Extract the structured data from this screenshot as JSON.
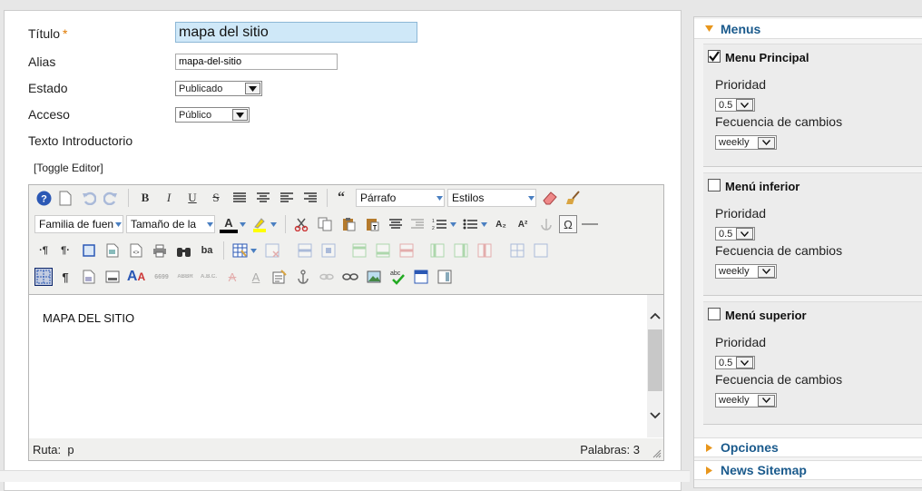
{
  "form": {
    "title_label": "Título",
    "required_mark": "*",
    "title_value": "mapa del sitio",
    "alias_label": "Alias",
    "alias_value": "mapa-del-sitio",
    "state_label": "Estado",
    "state_value": "Publicado",
    "access_label": "Acceso",
    "access_value": "Público",
    "intro_label": "Texto Introductorio",
    "toggle_editor": "[Toggle Editor]"
  },
  "editor": {
    "paragraph_format": "Párrafo",
    "styles": "Estilos",
    "font_family": "Familia de fuen",
    "font_size": "Tamaño de la",
    "content": "MAPA DEL SITIO",
    "path_label": "Ruta:",
    "path_value": "p",
    "word_count": "Palabras: 3",
    "buttons": {
      "bold": "B",
      "italic": "I",
      "underline": "U",
      "strike": "S",
      "blockquote": "“",
      "text_color": "A",
      "subscript": "A₂",
      "superscript": "A²",
      "omega": "Ω",
      "show_blocks": "¶",
      "ltr": "·¶",
      "rtl": "¶·",
      "replace": "ba",
      "cite": "6699",
      "abbr": "ABBR",
      "acronym": "A.B.C.",
      "del": "A",
      "ins": "A",
      "styleprops": "A",
      "spell": "abc"
    }
  },
  "sidebar": {
    "menus_title": "Menus",
    "priority_label": "Prioridad",
    "frequency_label": "Fecuencia de cambios",
    "items": [
      {
        "name": "Menu Principal",
        "checked": true,
        "priority": "0.5",
        "frequency": "weekly"
      },
      {
        "name": "Menú inferior",
        "checked": false,
        "priority": "0.5",
        "frequency": "weekly"
      },
      {
        "name": "Menú superior",
        "checked": false,
        "priority": "0.5",
        "frequency": "weekly"
      }
    ],
    "options_title": "Opciones",
    "news_title": "News Sitemap"
  },
  "colors": {
    "accent": "#1a5a8c",
    "title_bg": "#cfe8f8",
    "required": "#e07a00"
  }
}
